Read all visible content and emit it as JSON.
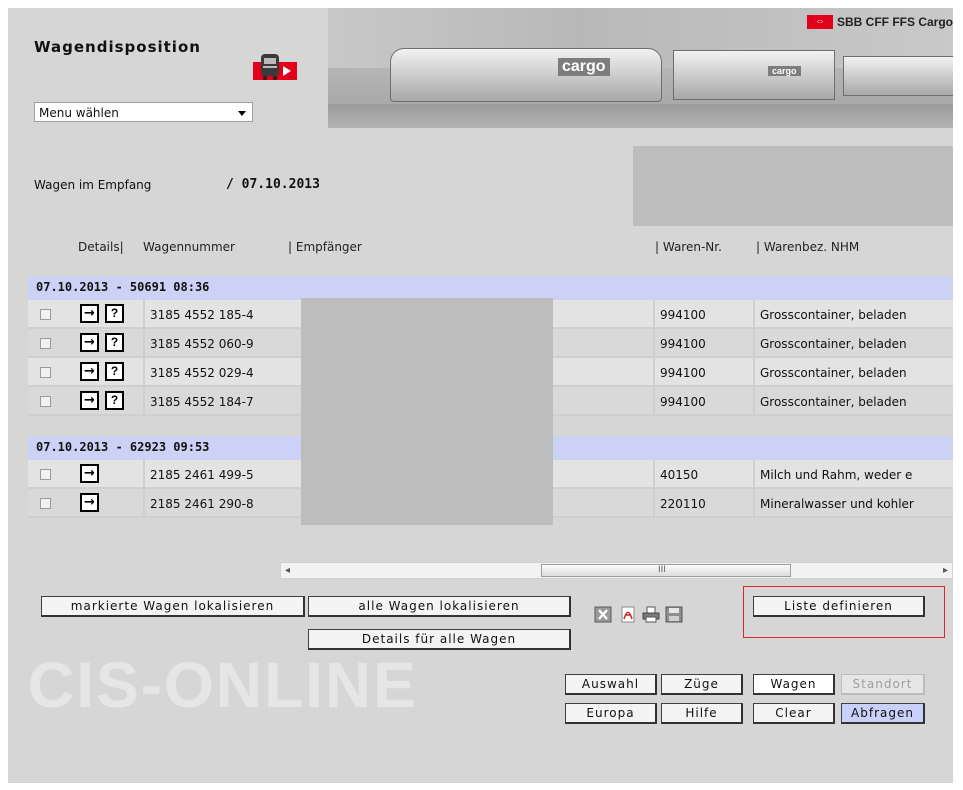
{
  "header": {
    "title": "Wagendisposition",
    "brand": "SBB CFF FFS Cargo",
    "wagon_label_1": "cargo",
    "wagon_label_2": "cargo",
    "menu": {
      "selected": "Menu wählen"
    }
  },
  "receipt": {
    "label": "Wagen im Empfang",
    "date": "/ 07.10.2013"
  },
  "columns": {
    "details": "Details|",
    "wagennummer": "Wagennummer",
    "empfaenger": "| Empfänger",
    "waren_nr": "| Waren-Nr.",
    "warenbez": "| Warenbez. NHM"
  },
  "groups": [
    {
      "title": "07.10.2013 - 50691 08:36",
      "rows": [
        {
          "wagennummer": "3185 4552 185-4",
          "waren_nr": "994100",
          "warenbez": "Grosscontainer, beladen"
        },
        {
          "wagennummer": "3185 4552 060-9",
          "waren_nr": "994100",
          "warenbez": "Grosscontainer, beladen"
        },
        {
          "wagennummer": "3185 4552 029-4",
          "waren_nr": "994100",
          "warenbez": "Grosscontainer, beladen"
        },
        {
          "wagennummer": "3185 4552 184-7",
          "waren_nr": "994100",
          "warenbez": "Grosscontainer, beladen"
        }
      ]
    },
    {
      "title": "07.10.2013 - 62923 09:53",
      "rows": [
        {
          "wagennummer": "2185 2461 499-5",
          "waren_nr": "40150",
          "warenbez": "Milch und Rahm, weder e"
        },
        {
          "wagennummer": "2185 2461 290-8",
          "waren_nr": "220110",
          "warenbez": "Mineralwasser und kohler"
        }
      ]
    }
  ],
  "icons": {
    "arrow": "→",
    "question": "?"
  },
  "actions": {
    "markierte": "markierte Wagen lokalisieren",
    "alle": "alle Wagen lokalisieren",
    "details_alle": "Details für alle Wagen",
    "liste_definieren": "Liste definieren"
  },
  "nav": {
    "auswahl": "Auswahl",
    "zuege": "Züge",
    "wagen": "Wagen",
    "standort": "Standort",
    "europa": "Europa",
    "hilfe": "Hilfe",
    "clear": "Clear",
    "abfragen": "Abfragen"
  },
  "logo_text": "CIS-ONLINE",
  "colors": {
    "group_header": "#ccd2f6",
    "highlight": "#e12626",
    "brand_red": "#e3001b"
  }
}
